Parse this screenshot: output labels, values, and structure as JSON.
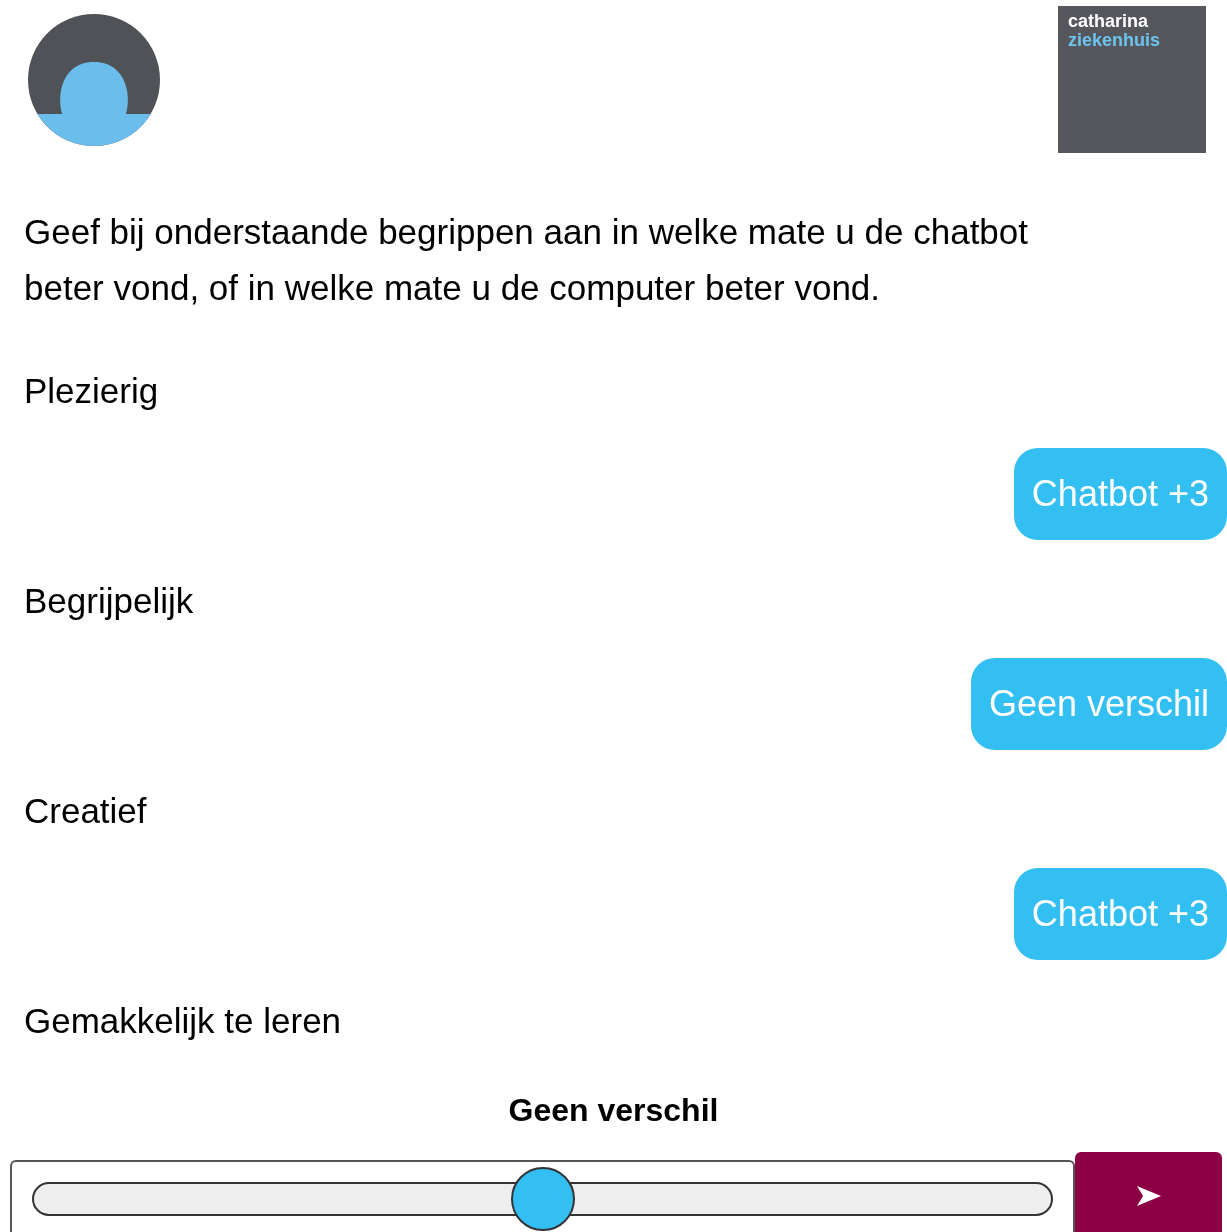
{
  "logo": {
    "line_1": "catharina",
    "line_2": "ziekenhuis"
  },
  "question": "Geef bij onderstaande begrippen aan in welke mate u de chatbot beter vond, of in welke mate u de computer beter vond.",
  "items": [
    {
      "label": "Plezierig",
      "answer": "Chatbot +3"
    },
    {
      "label": "Begrijpelijk",
      "answer": "Geen verschil"
    },
    {
      "label": "Creatief",
      "answer": "Chatbot +3"
    },
    {
      "label": "Gemakkelijk te leren"
    }
  ],
  "slider": {
    "value_label": "Geen verschil",
    "level": 0.5
  }
}
